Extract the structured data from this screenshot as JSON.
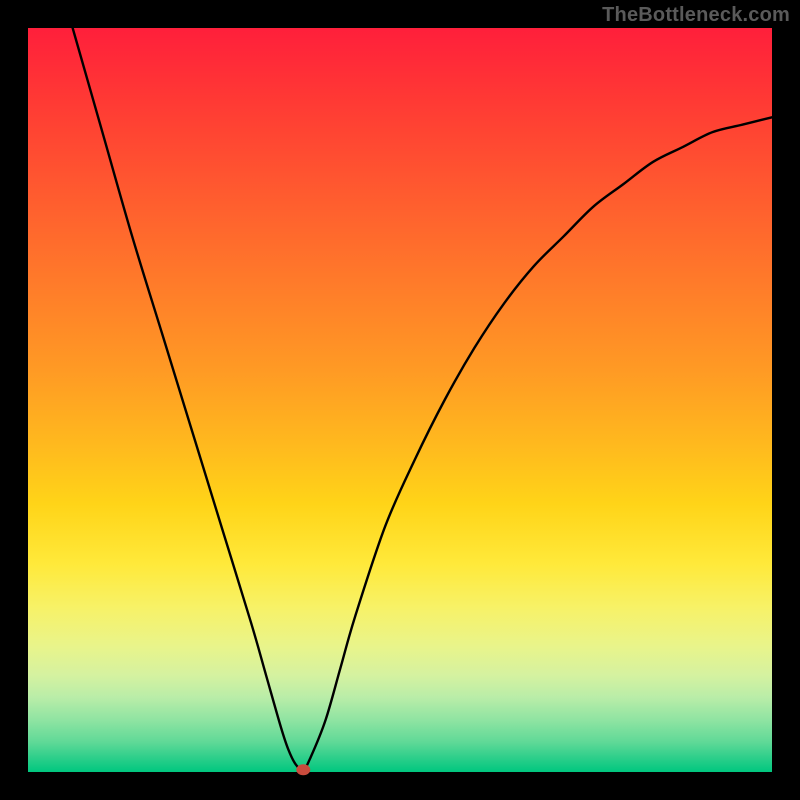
{
  "watermark": "TheBottleneck.com",
  "chart_data": {
    "type": "line",
    "title": "",
    "xlabel": "",
    "ylabel": "",
    "xlim": [
      0,
      100
    ],
    "ylim": [
      0,
      100
    ],
    "grid": false,
    "legend": false,
    "series": [
      {
        "name": "bottleneck-curve",
        "x": [
          6,
          10,
          14,
          18,
          22,
          26,
          30,
          32,
          34,
          35,
          36,
          37,
          38,
          40,
          42,
          44,
          48,
          52,
          56,
          60,
          64,
          68,
          72,
          76,
          80,
          84,
          88,
          92,
          96,
          100
        ],
        "values": [
          100,
          86,
          72,
          59,
          46,
          33,
          20,
          13,
          6,
          3,
          1,
          0.3,
          2,
          7,
          14,
          21,
          33,
          42,
          50,
          57,
          63,
          68,
          72,
          76,
          79,
          82,
          84,
          86,
          87,
          88
        ]
      }
    ],
    "minimum_point": {
      "x": 37,
      "value": 0.3
    },
    "background_gradient": {
      "top": "#ff1f3b",
      "bottom": "#00c77f"
    }
  }
}
